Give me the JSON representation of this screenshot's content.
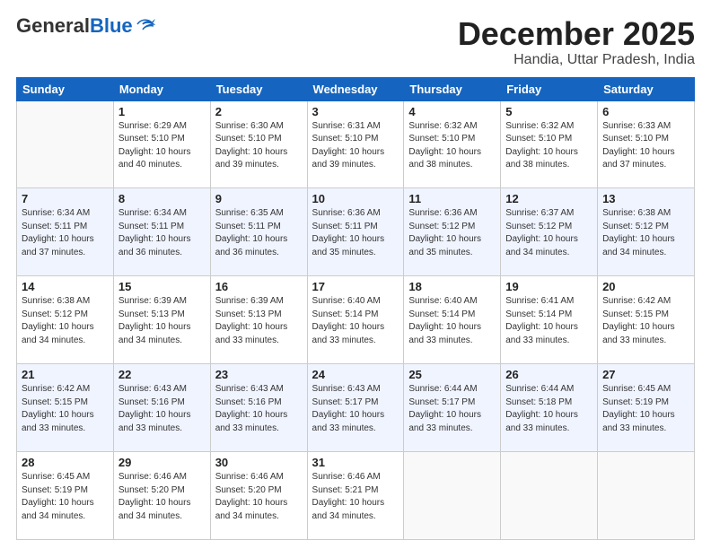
{
  "header": {
    "logo_general": "General",
    "logo_blue": "Blue",
    "month_title": "December 2025",
    "subtitle": "Handia, Uttar Pradesh, India"
  },
  "days_of_week": [
    "Sunday",
    "Monday",
    "Tuesday",
    "Wednesday",
    "Thursday",
    "Friday",
    "Saturday"
  ],
  "weeks": [
    [
      {
        "day": "",
        "info": ""
      },
      {
        "day": "1",
        "info": "Sunrise: 6:29 AM\nSunset: 5:10 PM\nDaylight: 10 hours\nand 40 minutes."
      },
      {
        "day": "2",
        "info": "Sunrise: 6:30 AM\nSunset: 5:10 PM\nDaylight: 10 hours\nand 39 minutes."
      },
      {
        "day": "3",
        "info": "Sunrise: 6:31 AM\nSunset: 5:10 PM\nDaylight: 10 hours\nand 39 minutes."
      },
      {
        "day": "4",
        "info": "Sunrise: 6:32 AM\nSunset: 5:10 PM\nDaylight: 10 hours\nand 38 minutes."
      },
      {
        "day": "5",
        "info": "Sunrise: 6:32 AM\nSunset: 5:10 PM\nDaylight: 10 hours\nand 38 minutes."
      },
      {
        "day": "6",
        "info": "Sunrise: 6:33 AM\nSunset: 5:10 PM\nDaylight: 10 hours\nand 37 minutes."
      }
    ],
    [
      {
        "day": "7",
        "info": "Sunrise: 6:34 AM\nSunset: 5:11 PM\nDaylight: 10 hours\nand 37 minutes."
      },
      {
        "day": "8",
        "info": "Sunrise: 6:34 AM\nSunset: 5:11 PM\nDaylight: 10 hours\nand 36 minutes."
      },
      {
        "day": "9",
        "info": "Sunrise: 6:35 AM\nSunset: 5:11 PM\nDaylight: 10 hours\nand 36 minutes."
      },
      {
        "day": "10",
        "info": "Sunrise: 6:36 AM\nSunset: 5:11 PM\nDaylight: 10 hours\nand 35 minutes."
      },
      {
        "day": "11",
        "info": "Sunrise: 6:36 AM\nSunset: 5:12 PM\nDaylight: 10 hours\nand 35 minutes."
      },
      {
        "day": "12",
        "info": "Sunrise: 6:37 AM\nSunset: 5:12 PM\nDaylight: 10 hours\nand 34 minutes."
      },
      {
        "day": "13",
        "info": "Sunrise: 6:38 AM\nSunset: 5:12 PM\nDaylight: 10 hours\nand 34 minutes."
      }
    ],
    [
      {
        "day": "14",
        "info": "Sunrise: 6:38 AM\nSunset: 5:12 PM\nDaylight: 10 hours\nand 34 minutes."
      },
      {
        "day": "15",
        "info": "Sunrise: 6:39 AM\nSunset: 5:13 PM\nDaylight: 10 hours\nand 34 minutes."
      },
      {
        "day": "16",
        "info": "Sunrise: 6:39 AM\nSunset: 5:13 PM\nDaylight: 10 hours\nand 33 minutes."
      },
      {
        "day": "17",
        "info": "Sunrise: 6:40 AM\nSunset: 5:14 PM\nDaylight: 10 hours\nand 33 minutes."
      },
      {
        "day": "18",
        "info": "Sunrise: 6:40 AM\nSunset: 5:14 PM\nDaylight: 10 hours\nand 33 minutes."
      },
      {
        "day": "19",
        "info": "Sunrise: 6:41 AM\nSunset: 5:14 PM\nDaylight: 10 hours\nand 33 minutes."
      },
      {
        "day": "20",
        "info": "Sunrise: 6:42 AM\nSunset: 5:15 PM\nDaylight: 10 hours\nand 33 minutes."
      }
    ],
    [
      {
        "day": "21",
        "info": "Sunrise: 6:42 AM\nSunset: 5:15 PM\nDaylight: 10 hours\nand 33 minutes."
      },
      {
        "day": "22",
        "info": "Sunrise: 6:43 AM\nSunset: 5:16 PM\nDaylight: 10 hours\nand 33 minutes."
      },
      {
        "day": "23",
        "info": "Sunrise: 6:43 AM\nSunset: 5:16 PM\nDaylight: 10 hours\nand 33 minutes."
      },
      {
        "day": "24",
        "info": "Sunrise: 6:43 AM\nSunset: 5:17 PM\nDaylight: 10 hours\nand 33 minutes."
      },
      {
        "day": "25",
        "info": "Sunrise: 6:44 AM\nSunset: 5:17 PM\nDaylight: 10 hours\nand 33 minutes."
      },
      {
        "day": "26",
        "info": "Sunrise: 6:44 AM\nSunset: 5:18 PM\nDaylight: 10 hours\nand 33 minutes."
      },
      {
        "day": "27",
        "info": "Sunrise: 6:45 AM\nSunset: 5:19 PM\nDaylight: 10 hours\nand 33 minutes."
      }
    ],
    [
      {
        "day": "28",
        "info": "Sunrise: 6:45 AM\nSunset: 5:19 PM\nDaylight: 10 hours\nand 34 minutes."
      },
      {
        "day": "29",
        "info": "Sunrise: 6:46 AM\nSunset: 5:20 PM\nDaylight: 10 hours\nand 34 minutes."
      },
      {
        "day": "30",
        "info": "Sunrise: 6:46 AM\nSunset: 5:20 PM\nDaylight: 10 hours\nand 34 minutes."
      },
      {
        "day": "31",
        "info": "Sunrise: 6:46 AM\nSunset: 5:21 PM\nDaylight: 10 hours\nand 34 minutes."
      },
      {
        "day": "",
        "info": ""
      },
      {
        "day": "",
        "info": ""
      },
      {
        "day": "",
        "info": ""
      }
    ]
  ]
}
